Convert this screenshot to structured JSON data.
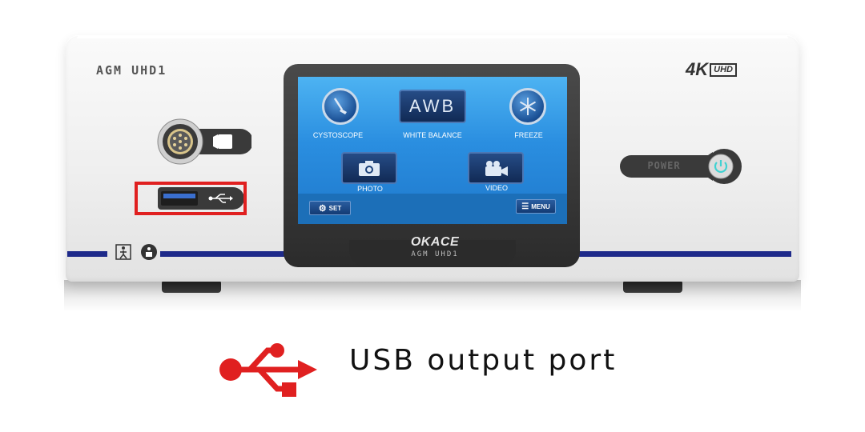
{
  "device": {
    "model_label": "AGM UHD1",
    "resolution_badge": {
      "big": "4K",
      "small": "UHD"
    },
    "power_label": "POWER",
    "brand": {
      "name": "OKACE",
      "model": "AGM UHD1"
    },
    "accent_color": "#1e2a8a",
    "highlight_color": "#e02020",
    "power_glow_color": "#3fd2d2"
  },
  "screen": {
    "buttons": {
      "cystoscope": {
        "label": "CYSTOSCOPE",
        "icon": "cystoscope-icon"
      },
      "white_balance": {
        "text": "AWB",
        "label": "WHITE BALANCE"
      },
      "freeze": {
        "label": "FREEZE",
        "icon": "snowflake-icon"
      },
      "photo": {
        "label": "PHOTO",
        "icon": "camera-icon"
      },
      "video": {
        "label": "VIDEO",
        "icon": "video-camera-icon"
      },
      "set": {
        "label": "SET",
        "icon": "gear-icon"
      },
      "menu": {
        "label": "MENU",
        "icon": "hamburger-icon"
      }
    }
  },
  "caption": {
    "text": "USB output port",
    "icon": "usb-icon"
  }
}
